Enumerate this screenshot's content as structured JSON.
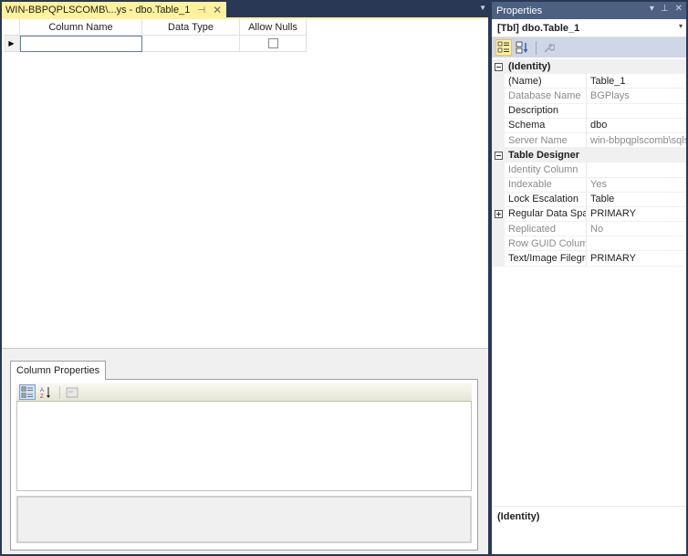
{
  "document": {
    "tab": {
      "title": "WIN-BBPQPLSCOMB\\...ys - dbo.Table_1",
      "pin_glyph": "⊣",
      "close_glyph": "✕",
      "active_color": "#fff29d"
    },
    "overflow_glyph": "▼",
    "grid": {
      "columns": [
        "Column Name",
        "Data Type",
        "Allow Nulls"
      ],
      "rows": [
        {
          "indicator": "▶",
          "column_name": "",
          "data_type": "",
          "allow_nulls": false
        }
      ]
    },
    "column_properties": {
      "tab_label": "Column Properties",
      "toolbar": [
        "categorized-icon",
        "alphabetical-icon",
        "property-pages-icon"
      ]
    }
  },
  "properties": {
    "title": "Properties",
    "title_buttons": [
      "▾",
      "⊥",
      "✕"
    ],
    "object": "[Tbl] dbo.Table_1",
    "object_dropdown": "▾",
    "toolbar": [
      "categorized-icon",
      "alphabetical-icon",
      "property-pages-icon"
    ],
    "categories": [
      {
        "name": "(Identity)",
        "expanded": true,
        "items": [
          {
            "name": "(Name)",
            "value": "Table_1",
            "readonly": false
          },
          {
            "name": "Database Name",
            "value": "BGPlays",
            "readonly": true
          },
          {
            "name": "Description",
            "value": "",
            "readonly": false
          },
          {
            "name": "Schema",
            "value": "dbo",
            "readonly": false
          },
          {
            "name": "Server Name",
            "value": "win-bbpqplscomb\\sqls",
            "readonly": true
          }
        ]
      },
      {
        "name": "Table Designer",
        "expanded": true,
        "items": [
          {
            "name": "Identity Column",
            "value": "",
            "readonly": true
          },
          {
            "name": "Indexable",
            "value": "Yes",
            "readonly": true
          },
          {
            "name": "Lock Escalation",
            "value": "Table",
            "readonly": false
          },
          {
            "name": "Regular Data Space",
            "value": "PRIMARY",
            "readonly": false,
            "expandable": true
          },
          {
            "name": "Replicated",
            "value": "No",
            "readonly": true
          },
          {
            "name": "Row GUID Column",
            "value": "",
            "readonly": true
          },
          {
            "name": "Text/Image Filegro",
            "value": "PRIMARY",
            "readonly": false
          }
        ]
      }
    ],
    "description_title": "(Identity)"
  }
}
